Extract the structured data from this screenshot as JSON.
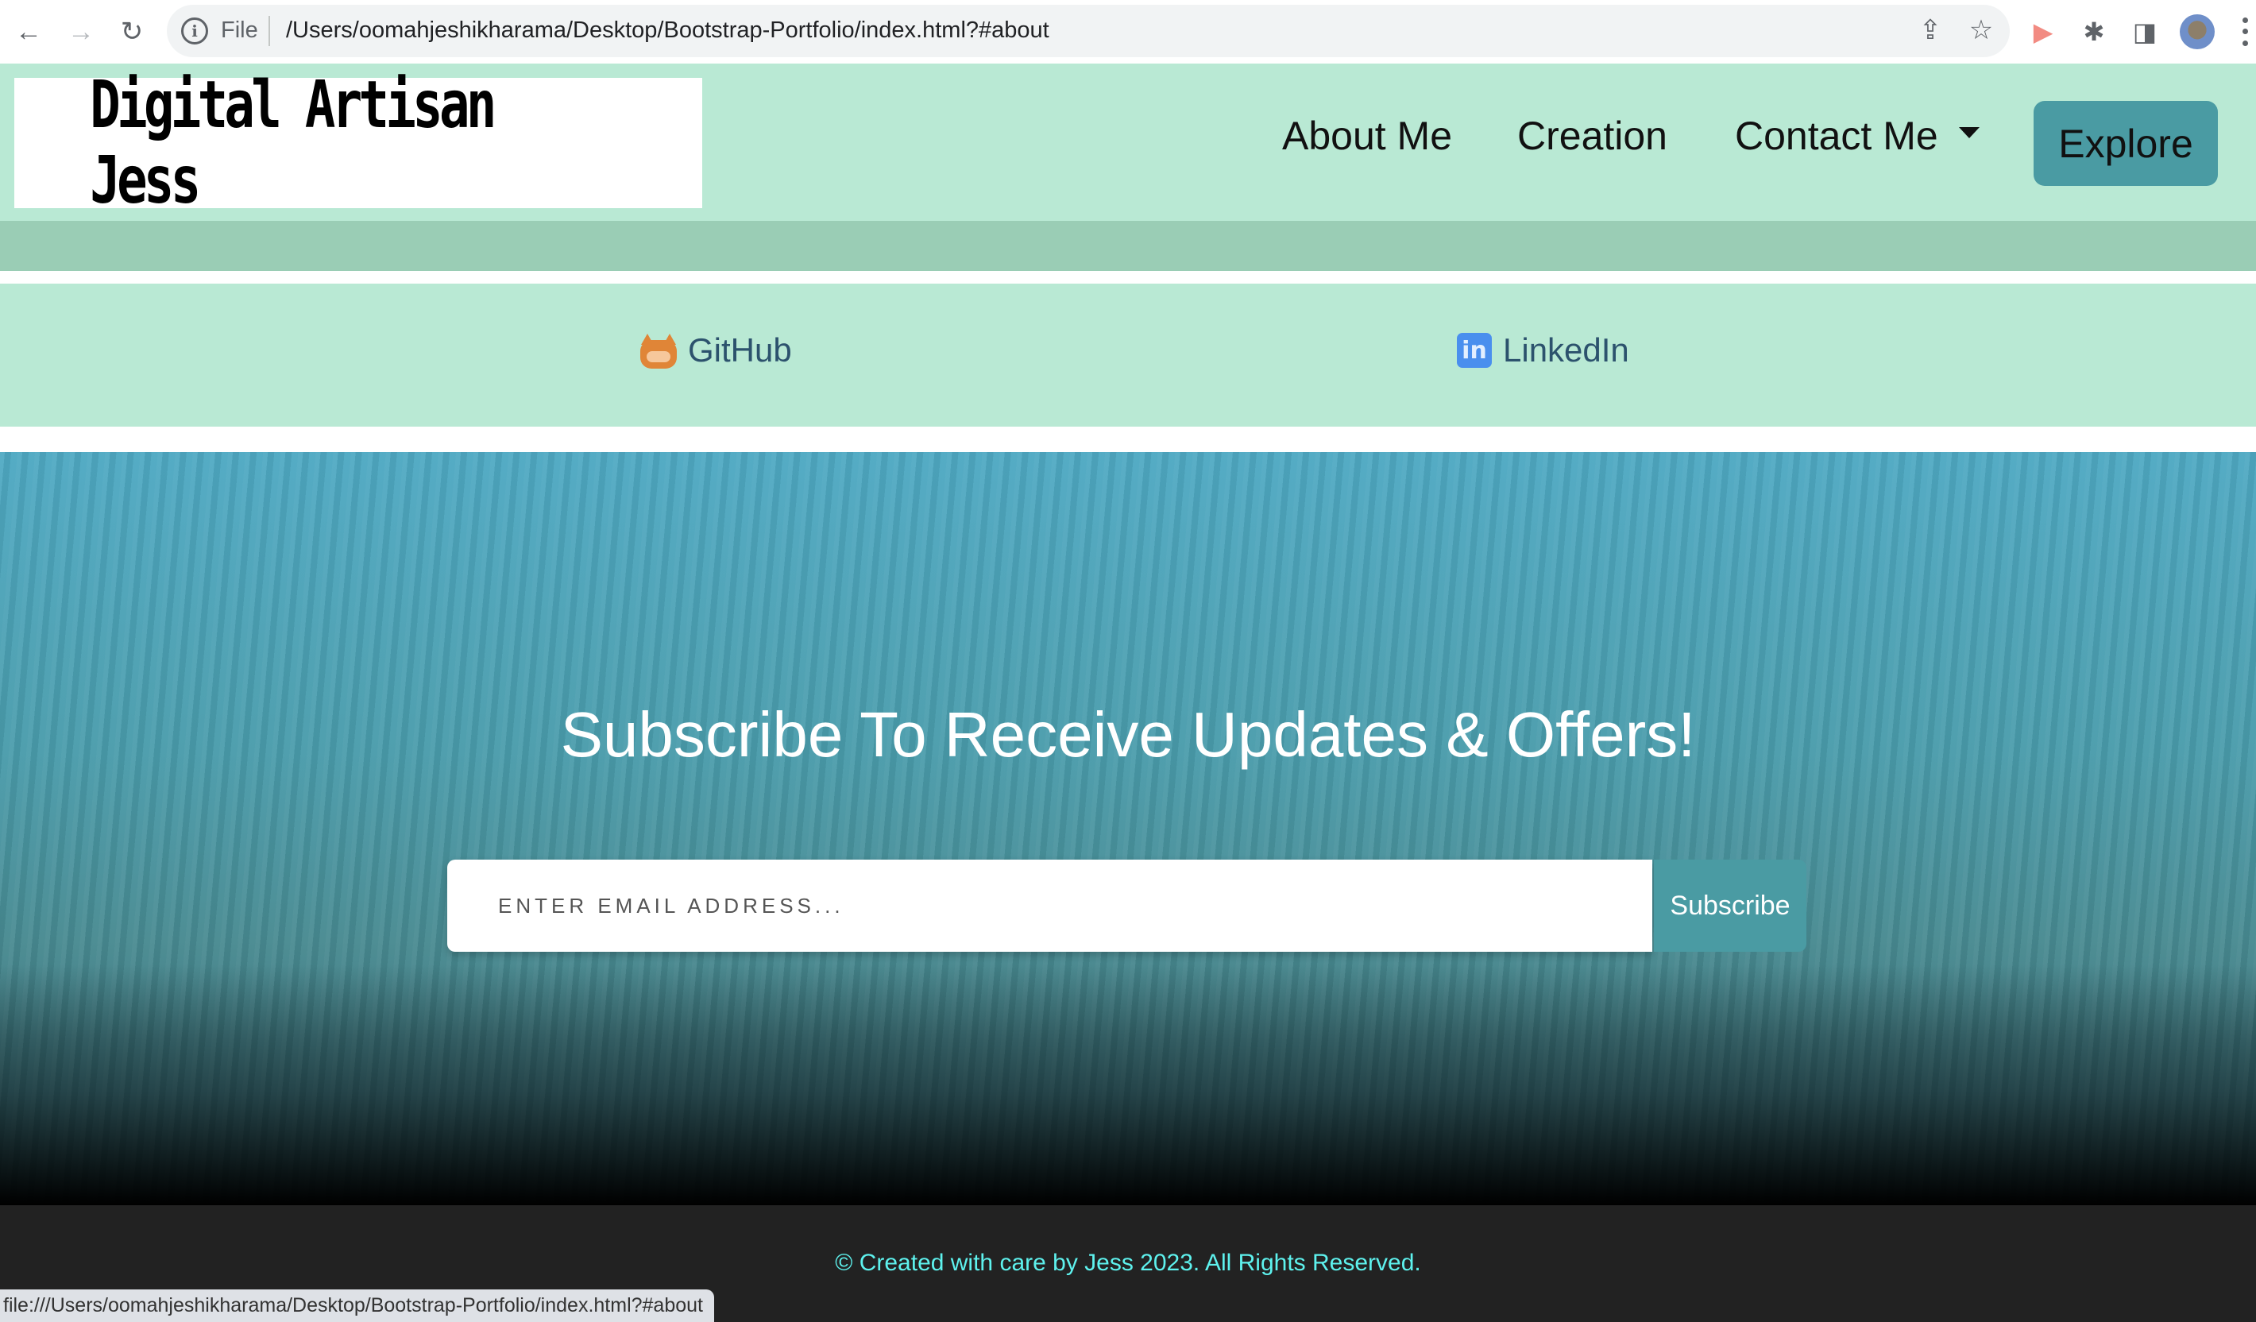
{
  "browser": {
    "back_icon": "←",
    "forward_icon": "→",
    "reload_icon": "↻",
    "info_icon": "i",
    "scheme_label": "File",
    "url": "/Users/oomahjeshikharama/Desktop/Bootstrap-Portfolio/index.html?#about",
    "share_icon": "⇪",
    "star_icon": "☆",
    "cast_icon": "▶",
    "extensions_icon": "✱",
    "sidepanel_icon": "◨",
    "status_url": "file:///Users/oomahjeshikharama/Desktop/Bootstrap-Portfolio/index.html?#about"
  },
  "nav": {
    "brand": "Digital Artisan Jess",
    "links": [
      {
        "label": "About Me"
      },
      {
        "label": "Creation"
      },
      {
        "label": "Contact Me"
      }
    ],
    "explore_label": "Explore"
  },
  "social": {
    "github_label": "GitHub",
    "linkedin_label": "LinkedIn",
    "linkedin_glyph": "in"
  },
  "subscribe": {
    "heading": "Subscribe To Receive Updates & Offers!",
    "email_placeholder": "ENTER EMAIL ADDRESS...",
    "email_value": "",
    "button_label": "Subscribe"
  },
  "footer": {
    "text": "© Created with care by Jess 2023. All Rights Reserved."
  },
  "colors": {
    "nav_bg": "#b9e9d4",
    "band_bg": "#9acdb5",
    "accent": "#4a9ba3",
    "footer_bg": "#222222",
    "footer_text": "#5ef2ee",
    "social_text": "#2c526d"
  }
}
